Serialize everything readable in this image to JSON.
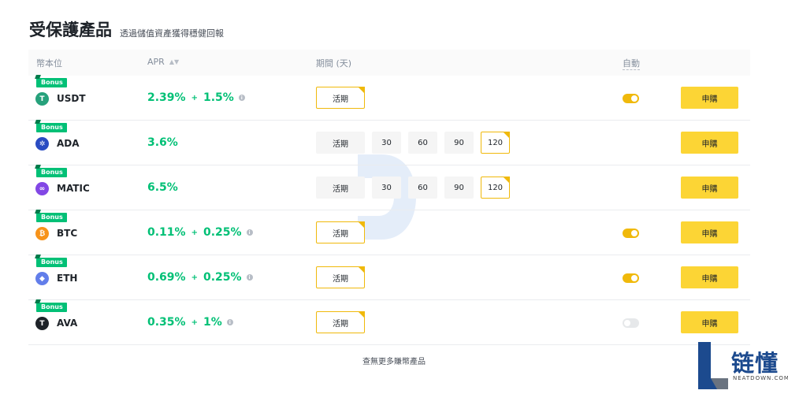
{
  "header": {
    "title": "受保護產品",
    "subtitle": "透過儲值資產獲得穩健回報"
  },
  "columns": {
    "coin": "幣本位",
    "apr": "APR",
    "period": "期間 (天)",
    "auto": "自動"
  },
  "bonus_label": "Bonus",
  "buy_label": "申購",
  "rows": [
    {
      "coin": "USDT",
      "coin_icon": "usdt-icon",
      "color": "#26a17b",
      "glyph": "T",
      "apr": "2.39%",
      "plus": "+",
      "bonus_apr": "1.5%",
      "periods": [
        "活期"
      ],
      "selected": "活期",
      "auto": "on"
    },
    {
      "coin": "ADA",
      "coin_icon": "ada-icon",
      "color": "#2a4cc2",
      "glyph": "✲",
      "apr": "3.6%",
      "periods": [
        "活期",
        "30",
        "60",
        "90",
        "120"
      ],
      "selected": "120",
      "auto": "none"
    },
    {
      "coin": "MATIC",
      "coin_icon": "matic-icon",
      "color": "#8247e5",
      "glyph": "∞",
      "apr": "6.5%",
      "periods": [
        "活期",
        "30",
        "60",
        "90",
        "120"
      ],
      "selected": "120",
      "auto": "none"
    },
    {
      "coin": "BTC",
      "coin_icon": "btc-icon",
      "color": "#f7931a",
      "glyph": "₿",
      "apr": "0.11%",
      "plus": "+",
      "bonus_apr": "0.25%",
      "periods": [
        "活期"
      ],
      "selected": "活期",
      "auto": "on"
    },
    {
      "coin": "ETH",
      "coin_icon": "eth-icon",
      "color": "#627eea",
      "glyph": "◆",
      "apr": "0.69%",
      "plus": "+",
      "bonus_apr": "0.25%",
      "periods": [
        "活期"
      ],
      "selected": "活期",
      "auto": "on"
    },
    {
      "coin": "AVA",
      "coin_icon": "ava-icon",
      "color": "#1e2329",
      "glyph": "T",
      "apr": "0.35%",
      "plus": "+",
      "bonus_apr": "1%",
      "periods": [
        "活期"
      ],
      "selected": "活期",
      "auto": "off"
    }
  ],
  "footer": {
    "more": "查無更多賺幣產品"
  },
  "branding": {
    "logo_text": "链懂",
    "logo_sub": "NEATDOWN.COM"
  },
  "colors": {
    "accent": "#f0b90b",
    "button": "#fcd535",
    "positive": "#02c076"
  }
}
